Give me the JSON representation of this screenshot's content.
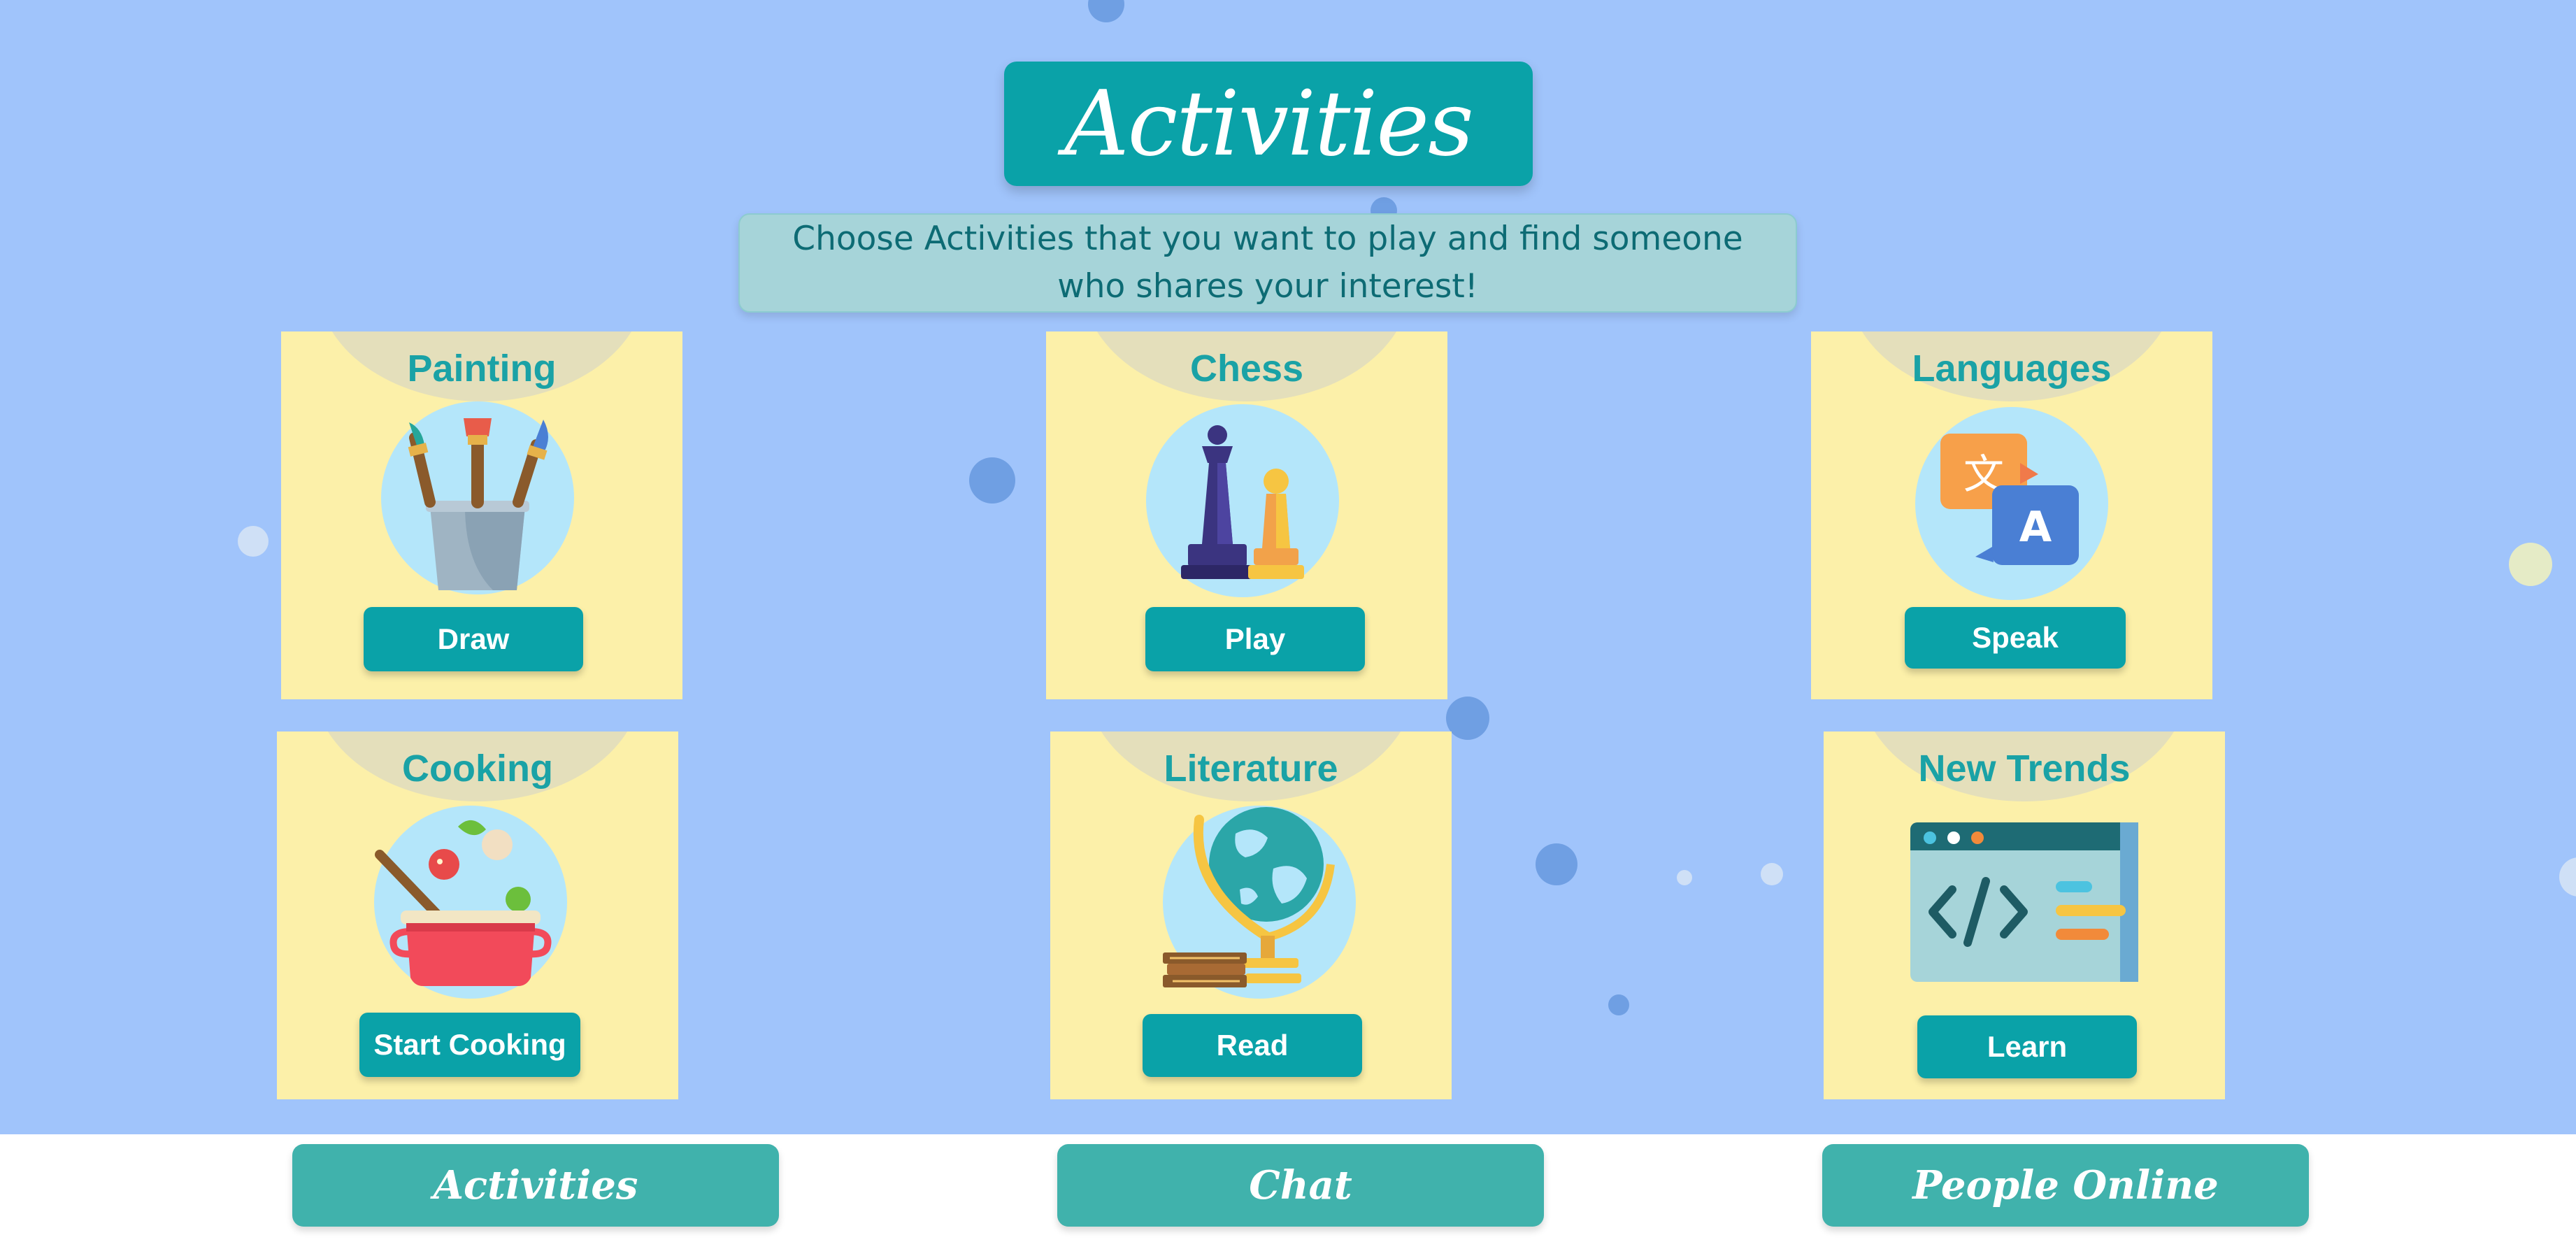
{
  "header": {
    "title": "Activities",
    "subtitle": "Choose Activities that you want to play and find someone who shares your interest!"
  },
  "cards": [
    {
      "title": "Painting",
      "button": "Draw",
      "icon": "paintbrushes-icon"
    },
    {
      "title": "Chess",
      "button": "Play",
      "icon": "chess-pieces-icon"
    },
    {
      "title": "Languages",
      "button": "Speak",
      "icon": "translate-icon"
    },
    {
      "title": "Cooking",
      "button": "Start Cooking",
      "icon": "cooking-pot-icon"
    },
    {
      "title": "Literature",
      "button": "Read",
      "icon": "globe-books-icon"
    },
    {
      "title": "New Trends",
      "button": "Learn",
      "icon": "code-window-icon"
    }
  ],
  "nav": {
    "activities": "Activities",
    "chat": "Chat",
    "people_online": "People Online"
  },
  "colors": {
    "background": "#a0c4fb",
    "accent": "#0aa2a8",
    "card": "#fcf0a9",
    "nav_button": "#40b2ac"
  }
}
